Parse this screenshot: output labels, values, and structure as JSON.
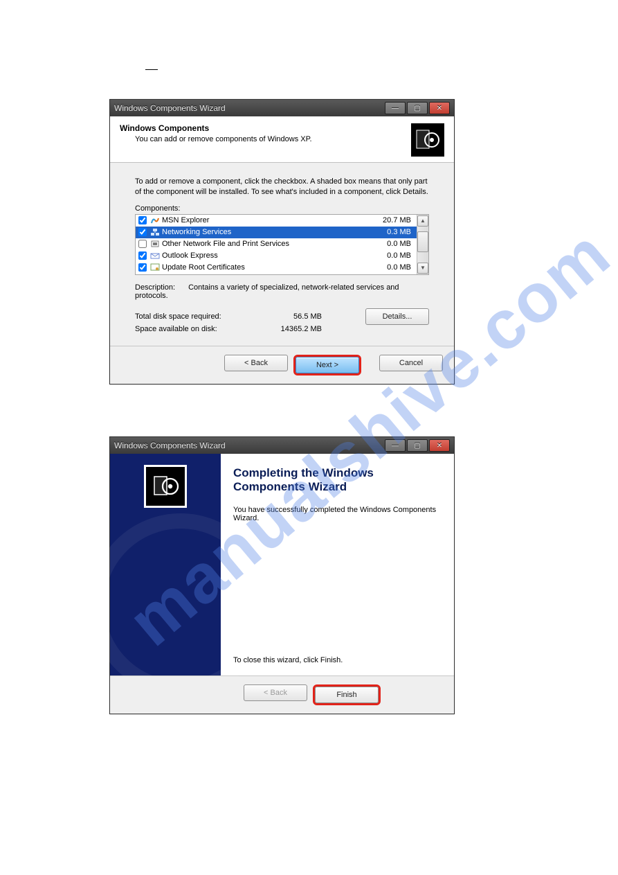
{
  "dialog1": {
    "title": "Windows Components Wizard",
    "header_title": "Windows Components",
    "header_sub": "You can add or remove components of Windows XP.",
    "instructions": "To add or remove a component, click the checkbox. A shaded box means that only part of the component will be installed. To see what's included in a component, click Details.",
    "components_label": "Components:",
    "items": [
      {
        "name": "MSN Explorer",
        "size": "20.7 MB",
        "checked": true,
        "selected": false
      },
      {
        "name": "Networking Services",
        "size": "0.3 MB",
        "checked": true,
        "selected": true
      },
      {
        "name": "Other Network File and Print Services",
        "size": "0.0 MB",
        "checked": false,
        "selected": false
      },
      {
        "name": "Outlook Express",
        "size": "0.0 MB",
        "checked": true,
        "selected": false
      },
      {
        "name": "Update Root Certificates",
        "size": "0.0 MB",
        "checked": true,
        "selected": false
      }
    ],
    "desc_label": "Description:",
    "desc_text": "Contains a variety of specialized, network-related services and protocols.",
    "req_label": "Total disk space required:",
    "req_value": "56.5 MB",
    "avail_label": "Space available on disk:",
    "avail_value": "14365.2 MB",
    "details_btn": "Details...",
    "back_btn": "< Back",
    "next_btn": "Next >",
    "cancel_btn": "Cancel"
  },
  "dialog2": {
    "title": "Windows Components Wizard",
    "heading": "Completing the Windows Components Wizard",
    "body": "You have successfully completed the Windows Components Wizard.",
    "close_hint": "To close this wizard, click Finish.",
    "back_btn": "< Back",
    "finish_btn": "Finish"
  },
  "watermark": "manualshive.com"
}
